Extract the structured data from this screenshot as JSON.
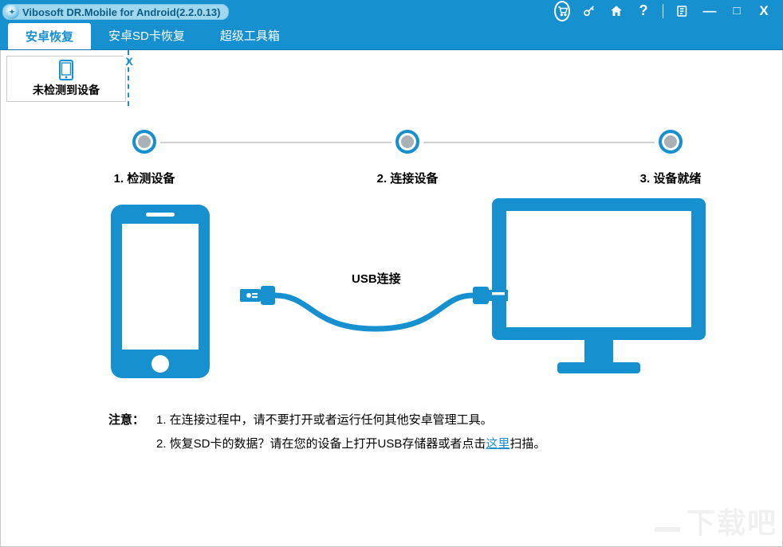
{
  "app": {
    "title": "Vibosoft DR.Mobile for Android(2.2.0.13)"
  },
  "tabs": [
    {
      "label": "安卓恢复",
      "active": true
    },
    {
      "label": "安卓SD卡恢复",
      "active": false
    },
    {
      "label": "超级工具箱",
      "active": false
    }
  ],
  "device_chip": {
    "label": "未检测到设备",
    "close": "X"
  },
  "steps": [
    {
      "label": "1. 检测设备"
    },
    {
      "label": "2. 连接设备"
    },
    {
      "label": "3. 设备就绪"
    }
  ],
  "illustration": {
    "usb_label": "USB连接"
  },
  "notes": {
    "heading": "注意：",
    "line1": "1. 在连接过程中，请不要打开或者运行任何其他安卓管理工具。",
    "line2_prefix": "2. 恢复SD卡的数据？请在您的设备上打开USB存储器或者点击",
    "line2_link": "这里",
    "line2_suffix": "扫描。"
  },
  "titlebar_icons": {
    "cart": "cart-icon",
    "key": "key-icon",
    "home": "home-icon",
    "help": "?",
    "feedback": "feedback-icon",
    "minimize": "—",
    "maximize": "□",
    "close": "X"
  },
  "watermark": "下载吧"
}
